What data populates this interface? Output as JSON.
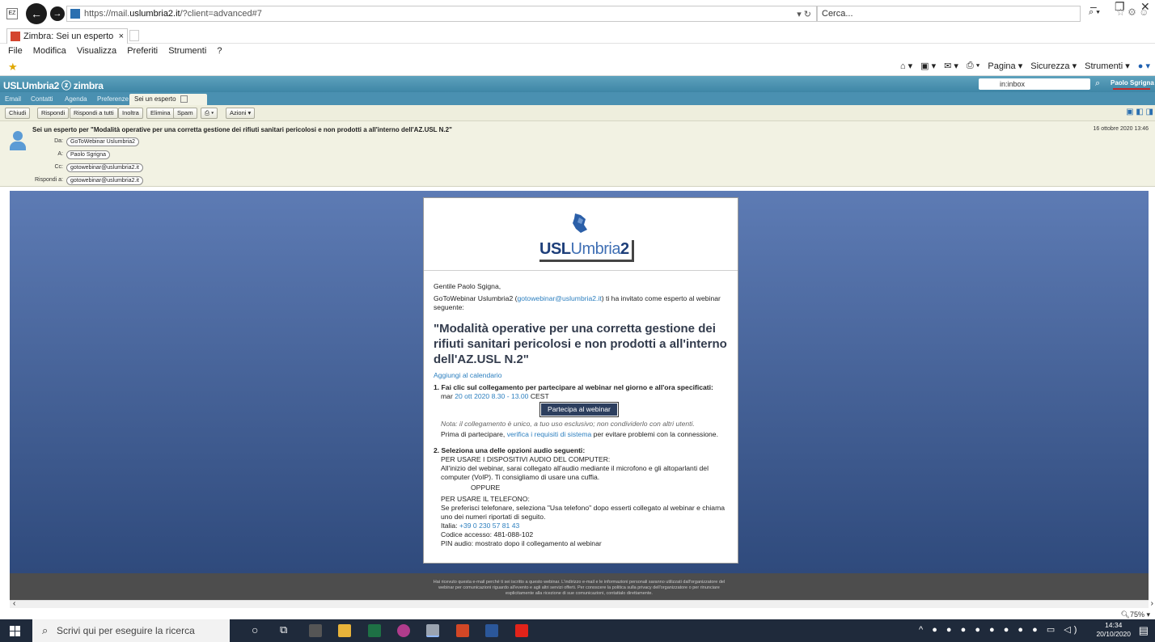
{
  "browser": {
    "url_prefix": "https://mail.",
    "url_domain": "uslumbria2.it",
    "url_suffix": "/?client=advanced#7",
    "search_placeholder": "Cerca...",
    "tab_title": "Zimbra: Sei un esperto per \"...",
    "menu": [
      "File",
      "Modifica",
      "Visualizza",
      "Preferiti",
      "Strumenti",
      "?"
    ],
    "commands": [
      "Pagina ▾",
      "Sicurezza ▾",
      "Strumenti ▾"
    ]
  },
  "zimbra": {
    "logo": "USLUmbria2 ⓩ zimbra",
    "search_value": "in:inbox",
    "user": "Paolo Sgrigna",
    "tabs": [
      "Email",
      "Contatti",
      "Agenda",
      "Preferenze",
      "Sei un esperto"
    ],
    "toolbar": [
      "Chiudi",
      "Rispondi",
      "Rispondi a tutti",
      "Inoltra",
      "Elimina",
      "Spam",
      "Azioni ▾"
    ],
    "subject": "Sei un esperto per \"Modalità operative per una corretta gestione dei rifiuti sanitari pericolosi e non prodotti a all'interno dell'AZ.USL N.2\"",
    "date": "16 ottobre 2020 13:46",
    "labels": {
      "from": "Da:",
      "to": "A:",
      "cc": "Cc:",
      "reply": "Rispondi a:"
    },
    "from": "GoToWebinar Uslumbria2",
    "to": "Paolo Sgrigna",
    "cc": "gotowebinar@uslumbria2.it",
    "reply_to": "gotowebinar@uslumbria2.it",
    "footer": "Hai ricevuto questa e-mail perché ti sei iscritto a questo webinar. L'indirizzo e-mail e le informazioni personali saranno utilizzati dall'organizzatore del webinar per comunicazioni riguardo all'evento e agli altri servizi offerti. Per conoscere la politica sulla privacy dell'organizzatore o per rinunciare esplicitamente alla ricezione di sue comunicazioni, contattalo direttamente.",
    "zoom": "75%"
  },
  "email": {
    "logo_usl": "USL",
    "logo_umbria": "Umbria",
    "logo_2": "2",
    "greeting": "Gentile Paolo Sgigna,",
    "intro_a": "GoToWebinar Uslumbria2 (",
    "intro_link": "gotowebinar@uslumbria2.it",
    "intro_b": ") ti ha invitato come esperto al webinar seguente:",
    "title": "\"Modalità operative per una corretta gestione dei rifiuti sanitari pericolosi e non prodotti a all'interno dell'AZ.USL N.2\"",
    "add_calendar": "Aggiungi al calendario",
    "step1": "1. Fai clic sul collegamento per partecipare al webinar nel giorno e all'ora specificati:",
    "date_prefix": "mar ",
    "date_link": "20 ott 2020 8.30 - 13.00",
    "date_suffix": " CEST",
    "join_button": "Partecipa al webinar",
    "note": "Nota: il collegamento è unico, a tuo uso esclusivo; non condividerlo con altri utenti.",
    "before_a": "Prima di partecipare, ",
    "before_link": "verifica i requisiti di sistema",
    "before_b": " per evitare problemi con la connessione.",
    "step2": "2. Seleziona una delle opzioni audio seguenti:",
    "audio_pc_title": "PER USARE I DISPOSITIVI AUDIO DEL COMPUTER:",
    "audio_pc_text": "All'inizio del webinar, sarai collegato all'audio mediante il microfono e gli altoparlanti del computer (VoIP). Ti consigliamo di usare una cuffia.",
    "oppure": "OPPURE",
    "phone_title": "PER USARE IL TELEFONO:",
    "phone_text": "Se preferisci telefonare, seleziona \"Usa telefono\" dopo esserti collegato al webinar e chiama uno dei numeri riportati di seguito.",
    "italy_label": "Italia: ",
    "italy_number": "+39 0 230 57 81 43",
    "access_code": "Codice accesso: 481-088-102",
    "pin": "PIN audio: mostrato dopo il collegamento al webinar"
  },
  "taskbar": {
    "search_placeholder": "Scrivi qui per eseguire la ricerca",
    "time": "14:34",
    "date": "20/10/2020"
  }
}
